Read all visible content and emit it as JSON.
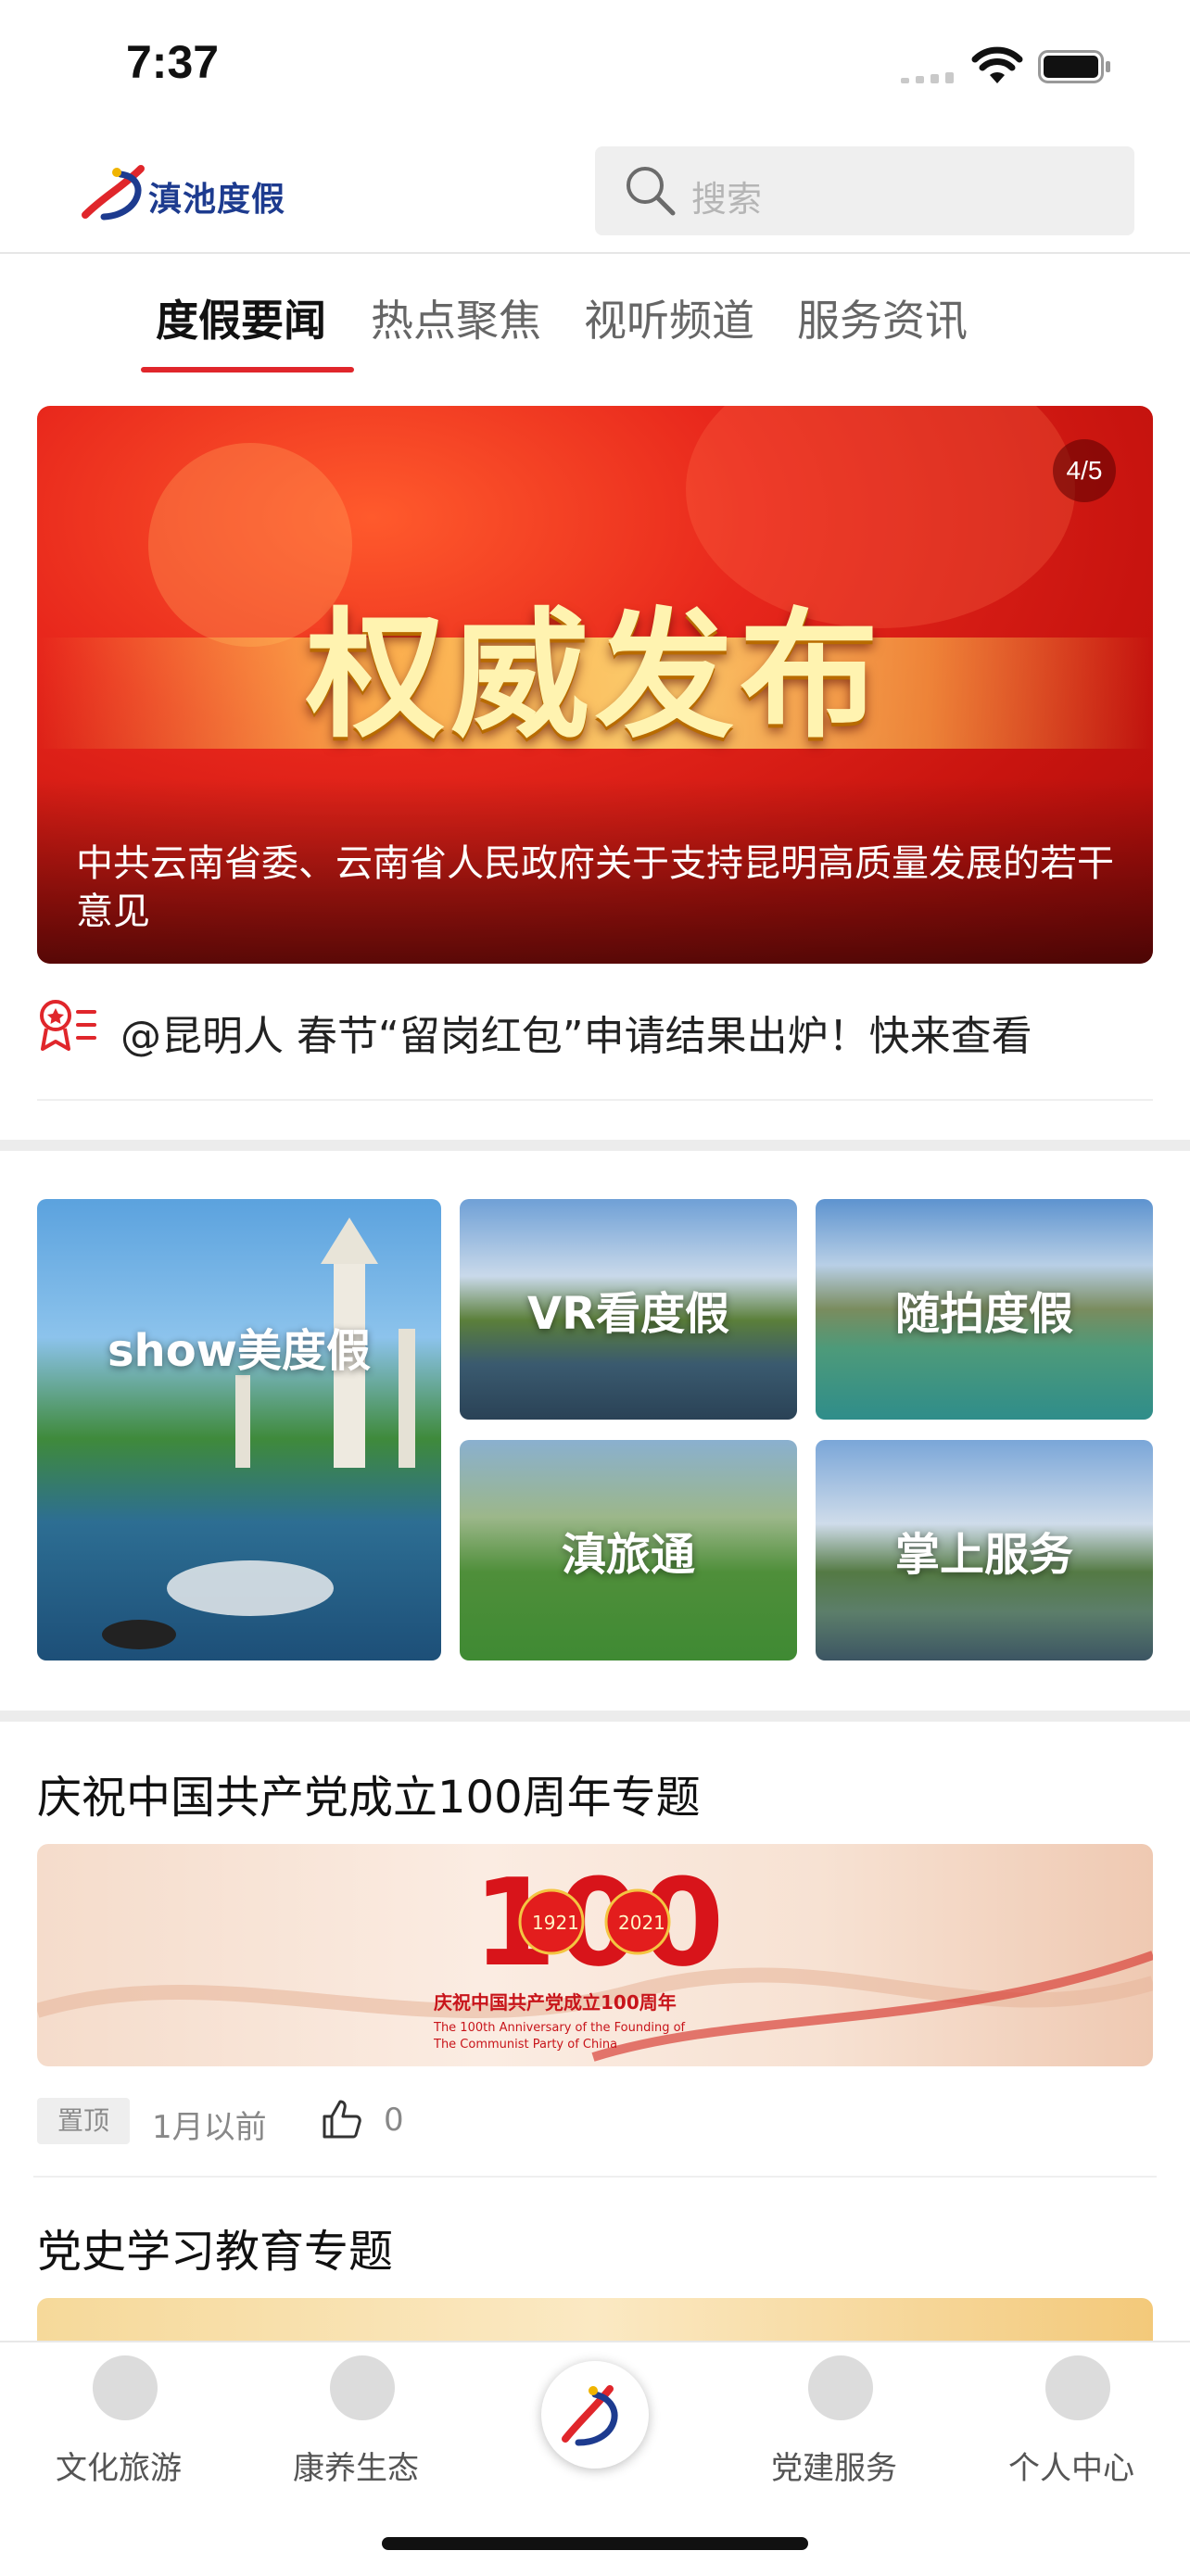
{
  "status_bar": {
    "time": "7:37"
  },
  "header": {
    "logo_text": "滇池度假",
    "search_placeholder": "搜索"
  },
  "tabs": [
    {
      "label": "度假要闻",
      "active": true
    },
    {
      "label": "热点聚焦",
      "active": false
    },
    {
      "label": "视听频道",
      "active": false
    },
    {
      "label": "服务资讯",
      "active": false
    }
  ],
  "banner": {
    "title": "权威发布",
    "caption": "中共云南省委、云南省人民政府关于支持昆明高质量发展的若干意见",
    "counter": "4/5"
  },
  "headline": {
    "text": "@昆明人 春节“留岗红包”申请结果出炉！快来查看"
  },
  "tiles": [
    {
      "label": "show美度假"
    },
    {
      "label": "VR看度假"
    },
    {
      "label": "随拍度假"
    },
    {
      "label": "滇旅通"
    },
    {
      "label": "掌上服务"
    }
  ],
  "topics": [
    {
      "title": "庆祝中国共产党成立100周年专题",
      "image_text": {
        "year_left": "1921",
        "year_right": "2021",
        "headline": "庆祝中国共产党成立100周年",
        "en_line1": "The 100th Anniversary of the Founding of",
        "en_line2": "The Communist Party of China"
      },
      "pin_label": "置顶",
      "time": "1月以前",
      "likes": "0"
    },
    {
      "title": "党史学习教育专题"
    }
  ],
  "tabbar": [
    {
      "label": "文化旅游",
      "icon": "culture-travel-icon"
    },
    {
      "label": "康养生态",
      "icon": "eco-leaf-icon"
    },
    {
      "label": "",
      "icon": "home-logo-icon"
    },
    {
      "label": "党建服务",
      "icon": "party-emblem-icon"
    },
    {
      "label": "个人中心",
      "icon": "profile-icon"
    }
  ],
  "colors": {
    "accent": "#e0262b",
    "brand_blue": "#1d3b8f"
  }
}
